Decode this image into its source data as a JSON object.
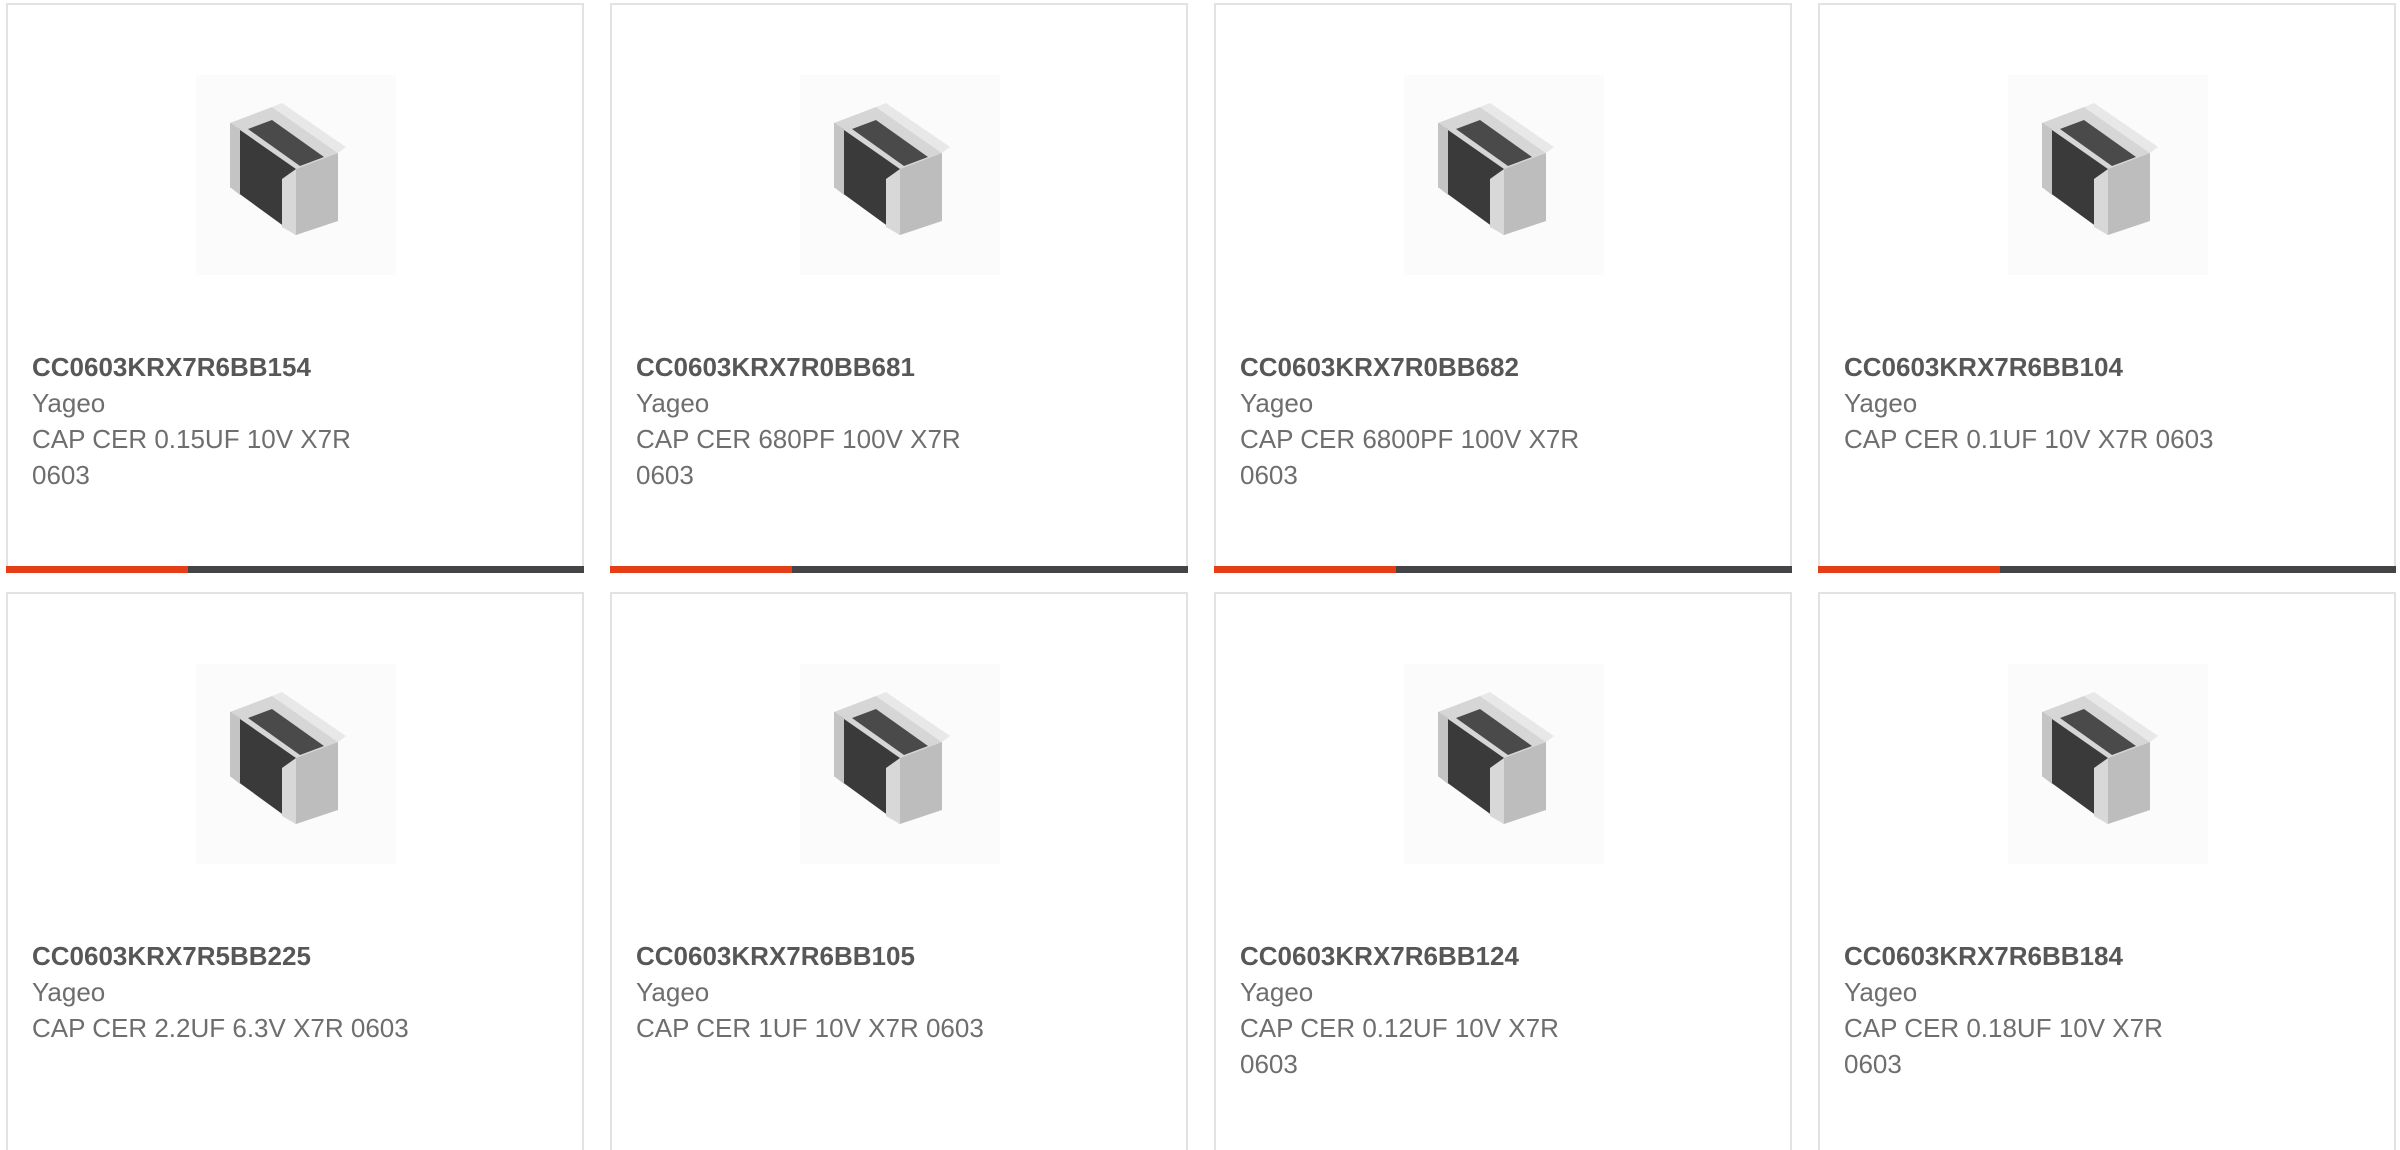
{
  "products": [
    {
      "part": "CC0603KRX7R6BB154",
      "manufacturer": "Yageo",
      "description": "CAP CER 0.15UF 10V X7R 0603",
      "image_icon": "chip-capacitor-icon"
    },
    {
      "part": "CC0603KRX7R0BB681",
      "manufacturer": "Yageo",
      "description": "CAP CER 680PF 100V X7R 0603",
      "image_icon": "chip-capacitor-icon"
    },
    {
      "part": "CC0603KRX7R0BB682",
      "manufacturer": "Yageo",
      "description": "CAP CER 6800PF 100V X7R 0603",
      "image_icon": "chip-capacitor-icon"
    },
    {
      "part": "CC0603KRX7R6BB104",
      "manufacturer": "Yageo",
      "description": "CAP CER 0.1UF 10V X7R 0603",
      "image_icon": "chip-capacitor-icon"
    },
    {
      "part": "CC0603KRX7R5BB225",
      "manufacturer": "Yageo",
      "description": "CAP CER 2.2UF 6.3V X7R 0603",
      "image_icon": "chip-capacitor-icon"
    },
    {
      "part": "CC0603KRX7R6BB105",
      "manufacturer": "Yageo",
      "description": "CAP CER 1UF 10V X7R 0603",
      "image_icon": "chip-capacitor-icon"
    },
    {
      "part": "CC0603KRX7R6BB124",
      "manufacturer": "Yageo",
      "description": "CAP CER 0.12UF 10V X7R 0603",
      "image_icon": "chip-capacitor-icon"
    },
    {
      "part": "CC0603KRX7R6BB184",
      "manufacturer": "Yageo",
      "description": "CAP CER 0.18UF 10V X7R 0603",
      "image_icon": "chip-capacitor-icon"
    }
  ],
  "colors": {
    "accent": "#e43e16",
    "bar": "#444446",
    "border": "#e2e2e2",
    "part_text": "#575757",
    "secondary_text": "#6e6e6e"
  }
}
